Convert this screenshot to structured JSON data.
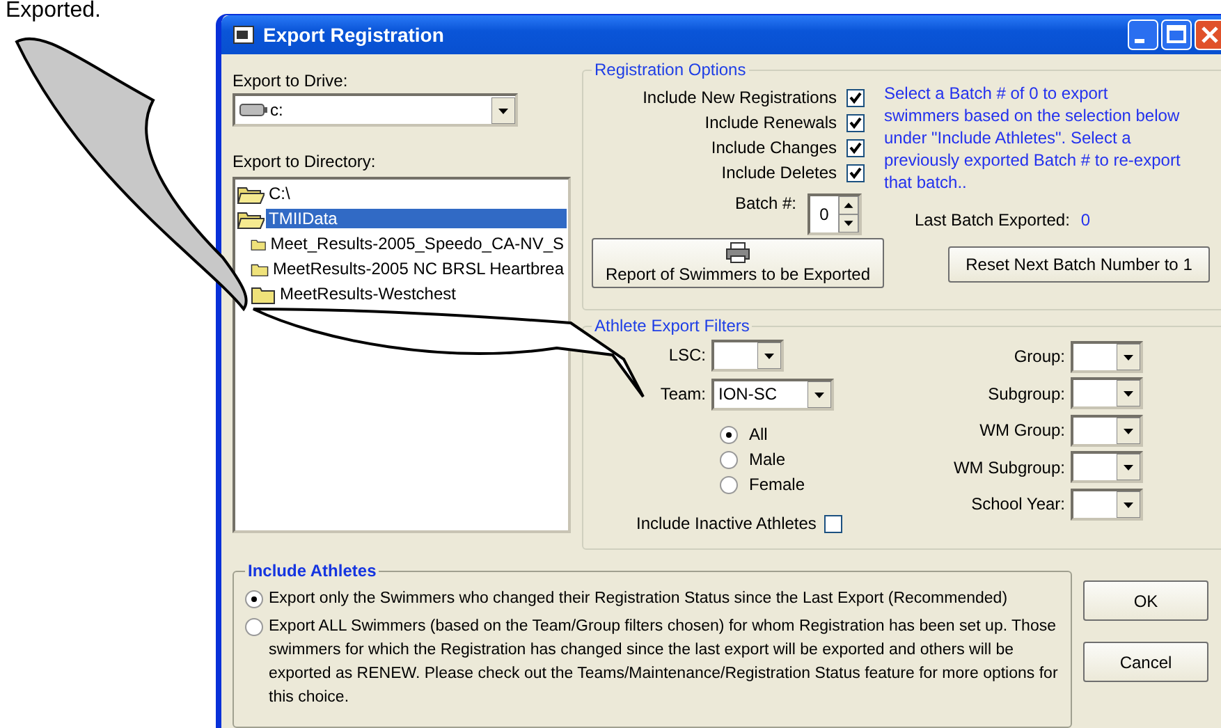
{
  "caption_text": "Exported.",
  "window": {
    "title": "Export Registration"
  },
  "drive": {
    "label": "Export to Drive:",
    "value": "c:"
  },
  "directory": {
    "label": "Export to Directory:",
    "items": [
      {
        "name": "C:\\",
        "kind": "open",
        "selected": false
      },
      {
        "name": "TMIIData",
        "kind": "open",
        "selected": true
      },
      {
        "name": "Meet_Results-2005_Speedo_CA-NV_S",
        "kind": "closed",
        "selected": false
      },
      {
        "name": "MeetResults-2005 NC BRSL Heartbrea",
        "kind": "closed",
        "selected": false
      },
      {
        "name": "MeetResults-Westchest",
        "kind": "closed",
        "selected": false
      }
    ]
  },
  "registration_options": {
    "legend": "Registration Options",
    "checkboxes": [
      {
        "label": "Include New Registrations",
        "checked": true
      },
      {
        "label": "Include Renewals",
        "checked": true
      },
      {
        "label": "Include Changes",
        "checked": true
      },
      {
        "label": "Include Deletes",
        "checked": true
      }
    ],
    "batch": {
      "label": "Batch #:",
      "value": "0"
    },
    "info_text": "Select a Batch # of 0 to export swimmers based on the selection below under \"Include Athletes\". Select a previously exported Batch # to re-export that batch..",
    "last_batch": {
      "label": "Last Batch Exported:",
      "value": "0"
    },
    "report_button": "Report of Swimmers to be Exported",
    "reset_button": "Reset Next Batch Number to 1"
  },
  "filters": {
    "legend": "Athlete Export Filters",
    "left_fields": [
      {
        "label": "LSC:"
      },
      {
        "label": "Team:",
        "value": "ION-SC"
      }
    ],
    "gender_options": [
      {
        "label": "All",
        "selected": true
      },
      {
        "label": "Male",
        "selected": false
      },
      {
        "label": "Female",
        "selected": false
      }
    ],
    "inactive": {
      "label": "Include Inactive Athletes",
      "checked": false
    },
    "right_fields": [
      {
        "label": "Group:"
      },
      {
        "label": "Subgroup:"
      },
      {
        "label": "WM Group:"
      },
      {
        "label": "WM Subgroup:"
      },
      {
        "label": "School Year:"
      }
    ]
  },
  "include_athletes": {
    "legend": "Include Athletes",
    "options": [
      {
        "label": "Export only the Swimmers who changed their Registration Status since the Last Export (Recommended)",
        "selected": true
      },
      {
        "label": "Export ALL Swimmers (based on the Team/Group filters chosen) for whom Registration has been set up.  Those swimmers for which the Registration has changed since the last export will be exported and others will be exported as RENEW.  Please check out the Teams/Maintenance/Registration Status feature for more options for this choice.",
        "selected": false
      }
    ]
  },
  "buttons": [
    "OK",
    "Cancel"
  ]
}
